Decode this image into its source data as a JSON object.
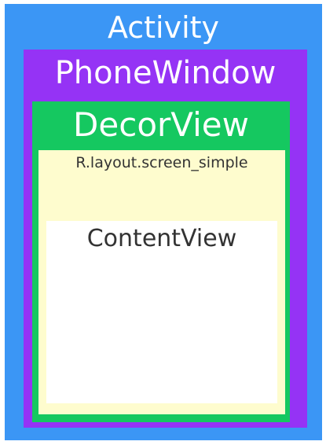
{
  "activity": {
    "label": "Activity"
  },
  "phone_window": {
    "label": "PhoneWindow"
  },
  "decor_view": {
    "label": "DecorView"
  },
  "screen_simple": {
    "label": "R.layout.screen_simple"
  },
  "content_view": {
    "label": "ContentView"
  },
  "colors": {
    "activity": "#3b96f5",
    "phone_window": "#9533f5",
    "decor_view": "#15c860",
    "screen_simple": "#fefcce",
    "content_view": "#ffffff",
    "light_text": "#ffffff",
    "dark_text": "#333333"
  }
}
